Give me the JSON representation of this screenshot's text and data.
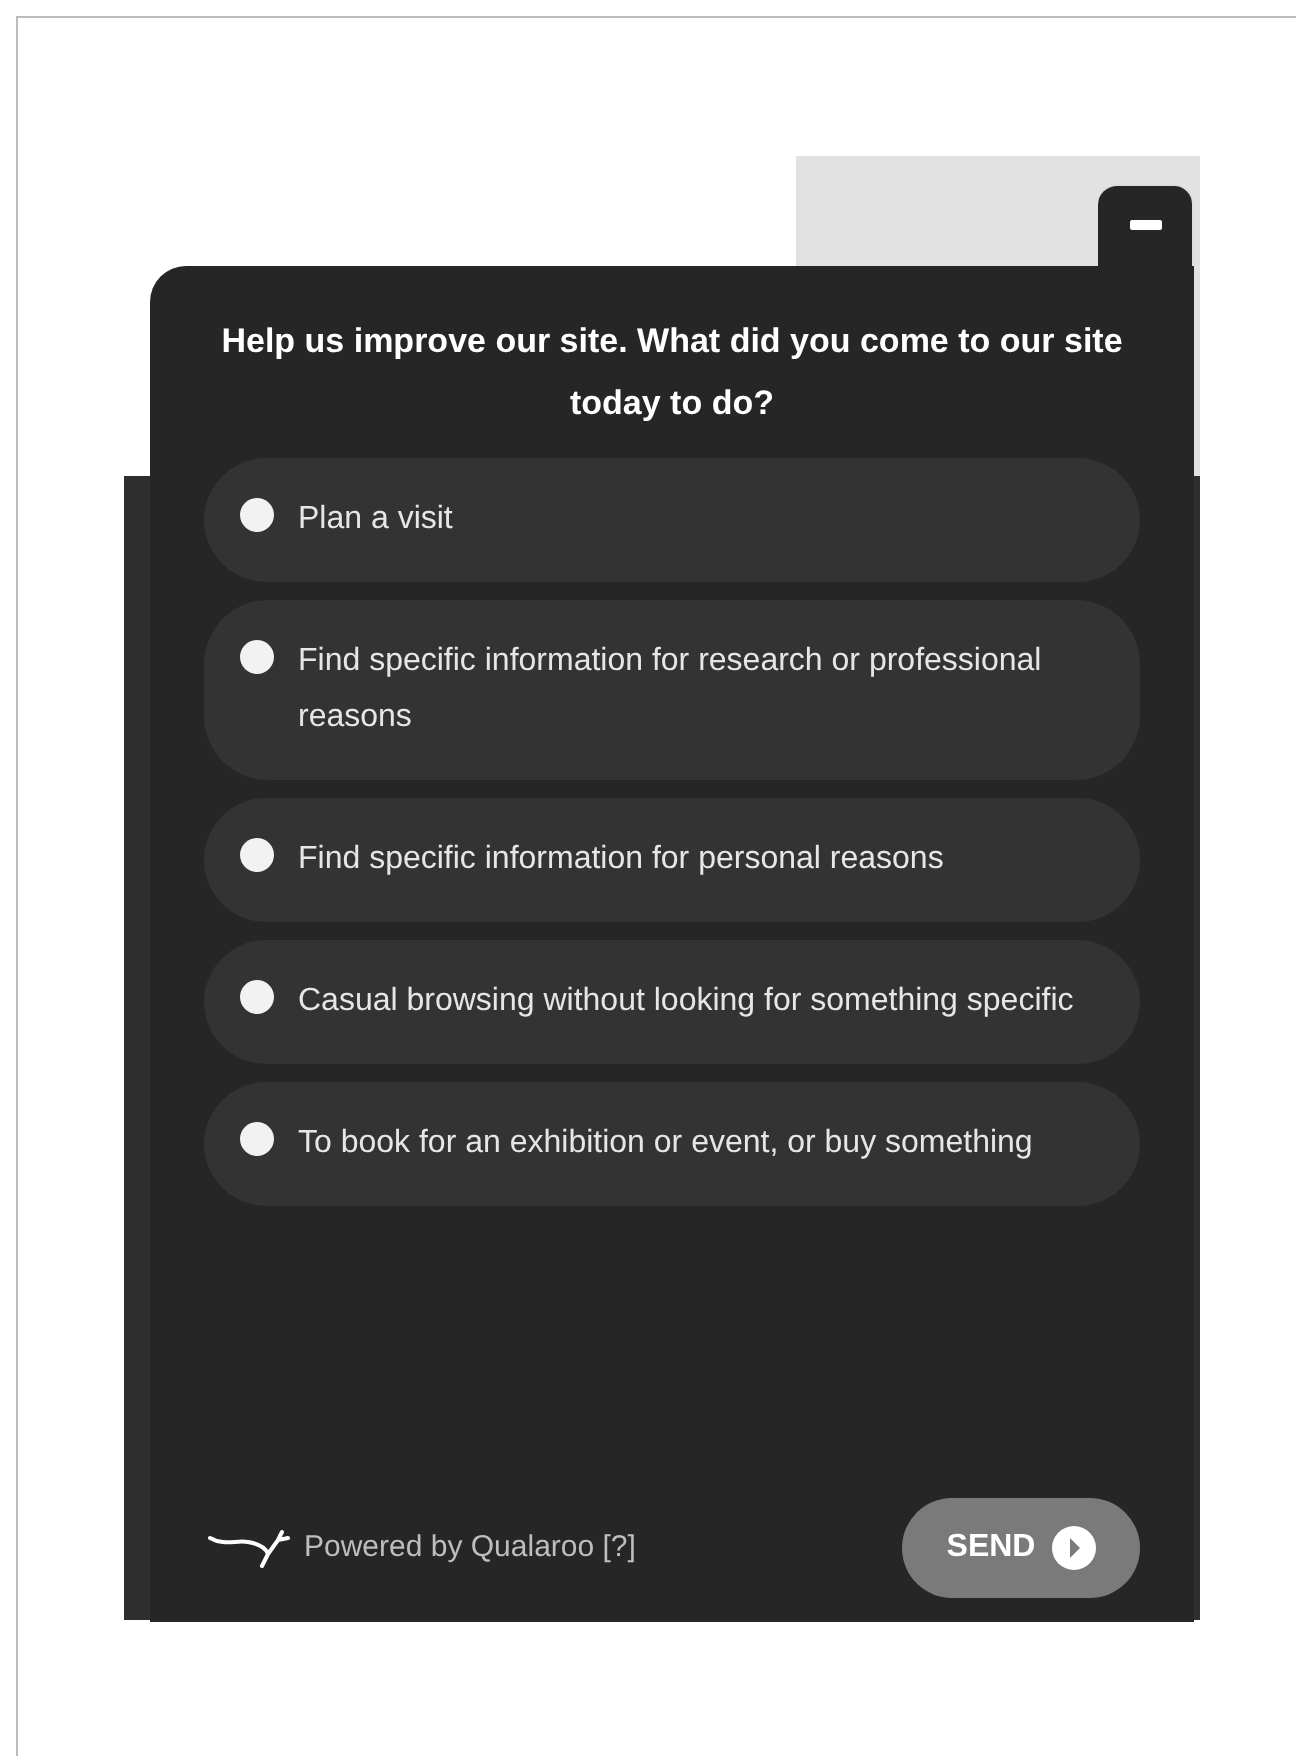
{
  "survey": {
    "question": "Help us improve our site. What did you come to our site today to do?",
    "options": [
      {
        "label": "Plan a visit",
        "selected": false
      },
      {
        "label": "Find specific information for research or professional reasons",
        "selected": false
      },
      {
        "label": "Find specific information for personal reasons",
        "selected": false
      },
      {
        "label": "Casual browsing without looking for something specific",
        "selected": false
      },
      {
        "label": "To book for an exhibition or event, or buy something",
        "selected": false
      }
    ],
    "footer": "Powered by Qualaroo [?]",
    "send": "SEND"
  }
}
